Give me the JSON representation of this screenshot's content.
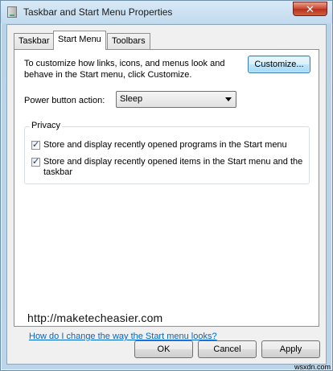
{
  "window": {
    "title": "Taskbar and Start Menu Properties",
    "close_glyph": "✕"
  },
  "tabs": [
    {
      "label": "Taskbar",
      "active": false
    },
    {
      "label": "Start Menu",
      "active": true
    },
    {
      "label": "Toolbars",
      "active": false
    }
  ],
  "start_menu": {
    "description": "To customize how links, icons, and menus look and behave in the Start menu, click Customize.",
    "customize_label": "Customize...",
    "power_label": "Power button action:",
    "power_value": "Sleep",
    "privacy": {
      "title": "Privacy",
      "items": [
        {
          "label": "Store and display recently opened programs in the Start menu",
          "checked": true
        },
        {
          "label": "Store and display recently opened items in the Start menu and the taskbar",
          "checked": true
        }
      ]
    },
    "watermark": "http://maketecheasier.com",
    "help_link": "How do I change the way the Start menu looks?"
  },
  "buttons": {
    "ok": "OK",
    "cancel": "Cancel",
    "apply": "Apply"
  },
  "source_mark": "wsxdn.com",
  "icons": {
    "title_icon": "taskbar-properties-icon",
    "close_icon": "close-icon",
    "dropdown_icon": "chevron-down-icon",
    "check_icon": "checkmark-icon"
  }
}
